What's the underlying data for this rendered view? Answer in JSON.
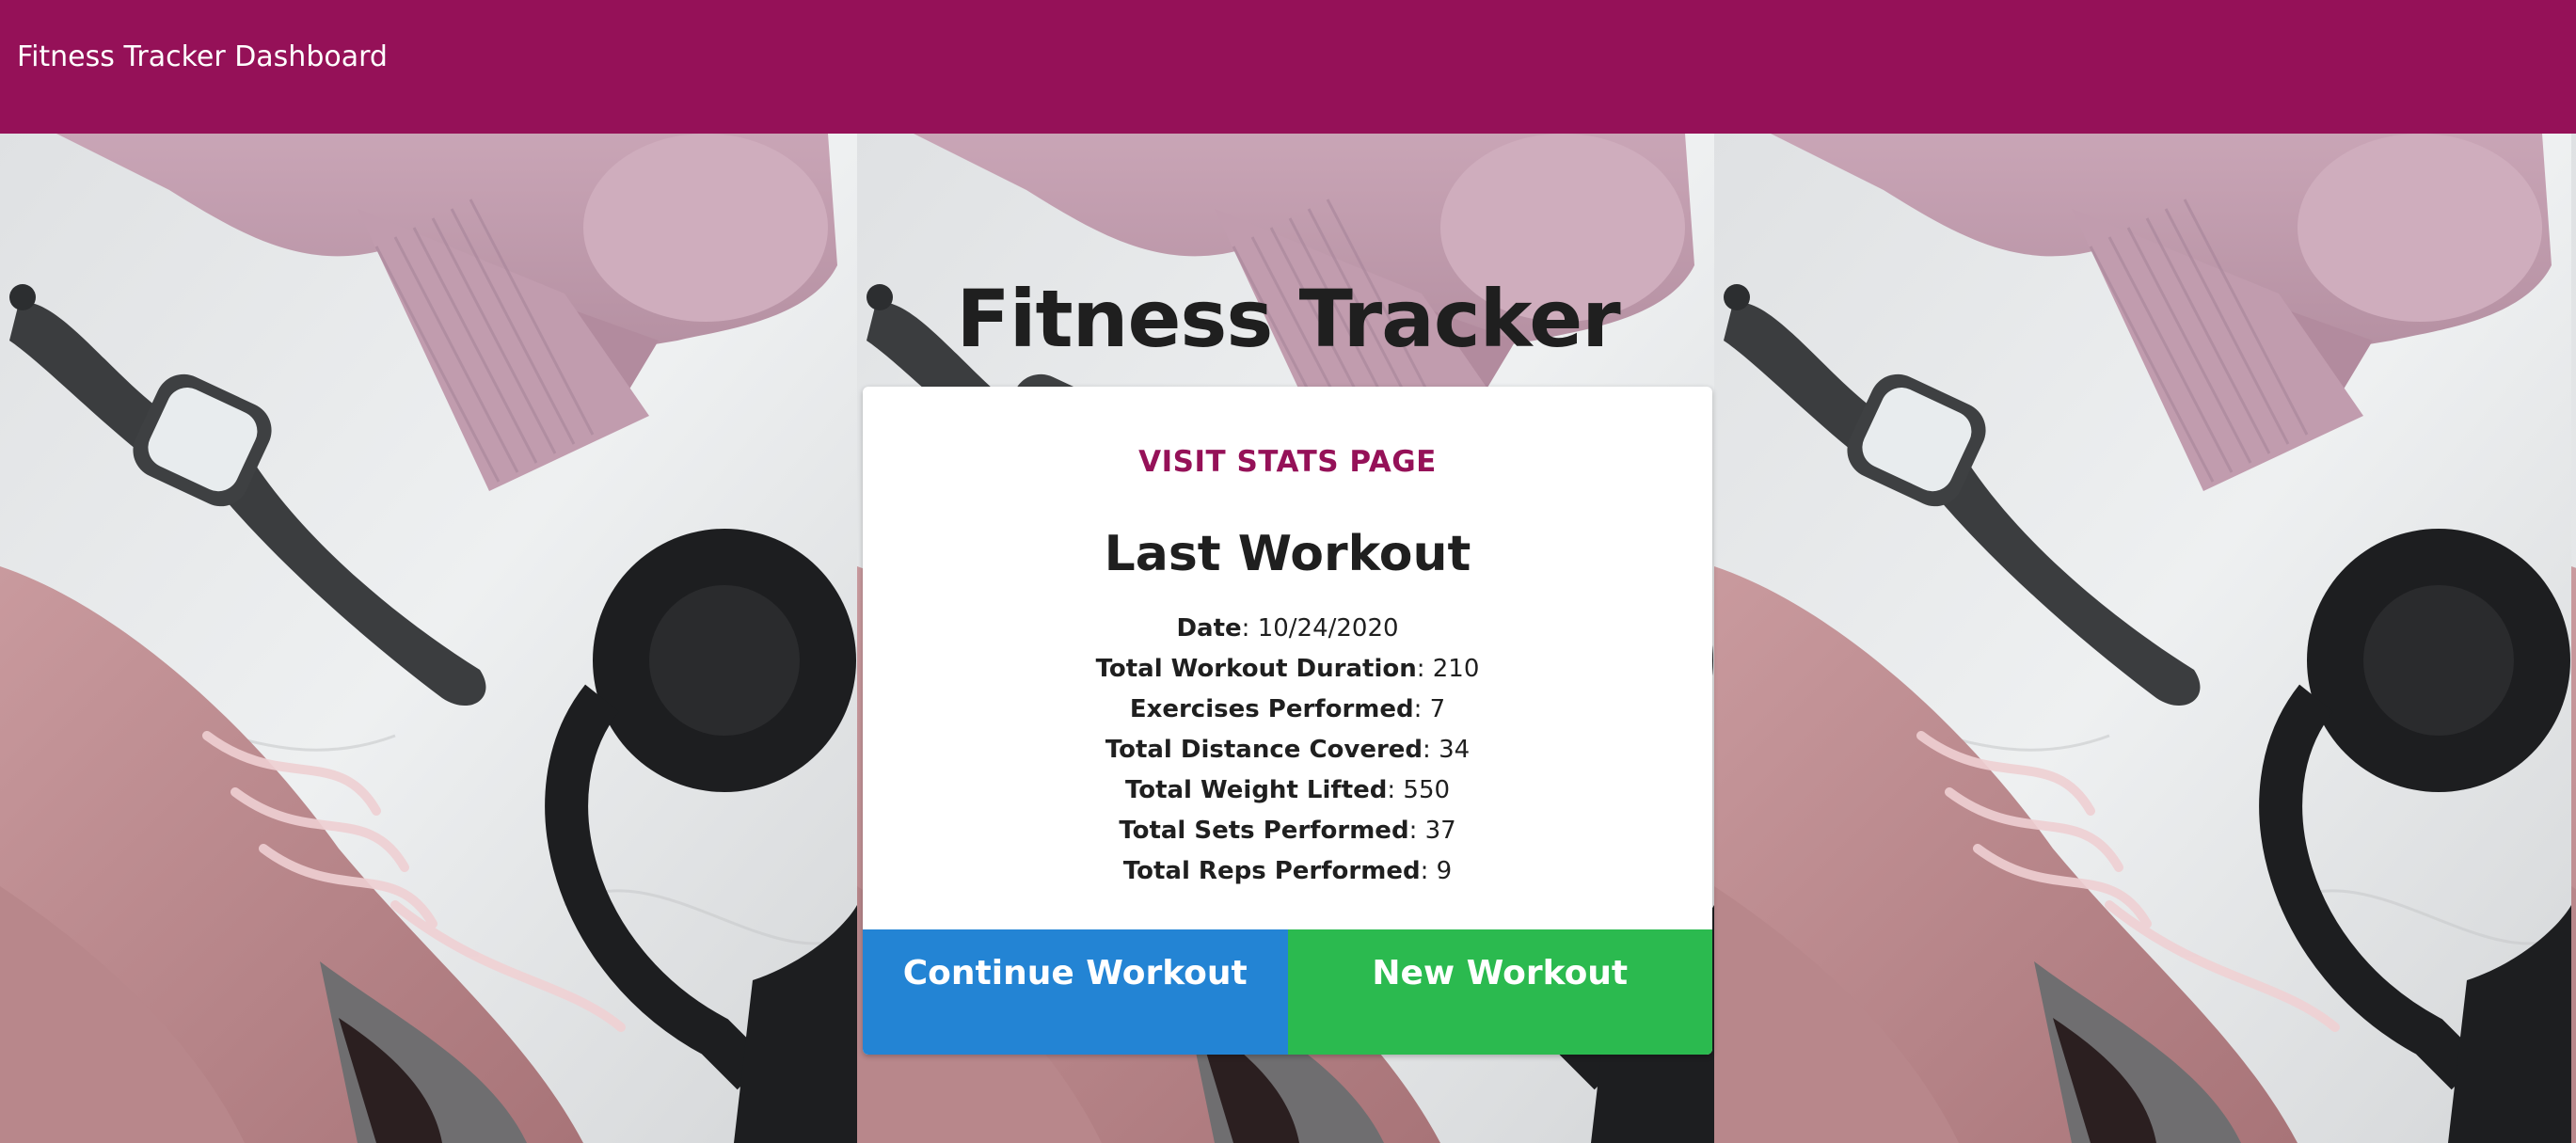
{
  "navbar": {
    "brand": "Fitness Tracker Dashboard",
    "background_color": "#951158"
  },
  "hero": {
    "title": "Fitness Tracker"
  },
  "card": {
    "stats_link": "VISIT STATS PAGE",
    "title": "Last Workout",
    "stats": [
      {
        "label": "Date",
        "value": "10/24/2020"
      },
      {
        "label": "Total Workout Duration",
        "value": "210"
      },
      {
        "label": "Exercises Performed",
        "value": "7"
      },
      {
        "label": "Total Distance Covered",
        "value": "34"
      },
      {
        "label": "Total Weight Lifted",
        "value": "550"
      },
      {
        "label": "Total Sets Performed",
        "value": "37"
      },
      {
        "label": "Total Reps Performed",
        "value": "9"
      }
    ],
    "buttons": {
      "continue_label": "Continue Workout",
      "new_label": "New Workout"
    }
  },
  "colors": {
    "accent": "#951158",
    "continue_button": "#2384d4",
    "new_button": "#2bba4f"
  },
  "background_image": {
    "subject": "smartwatch, pink sports bra, headphones, pink sneakers on marble"
  }
}
